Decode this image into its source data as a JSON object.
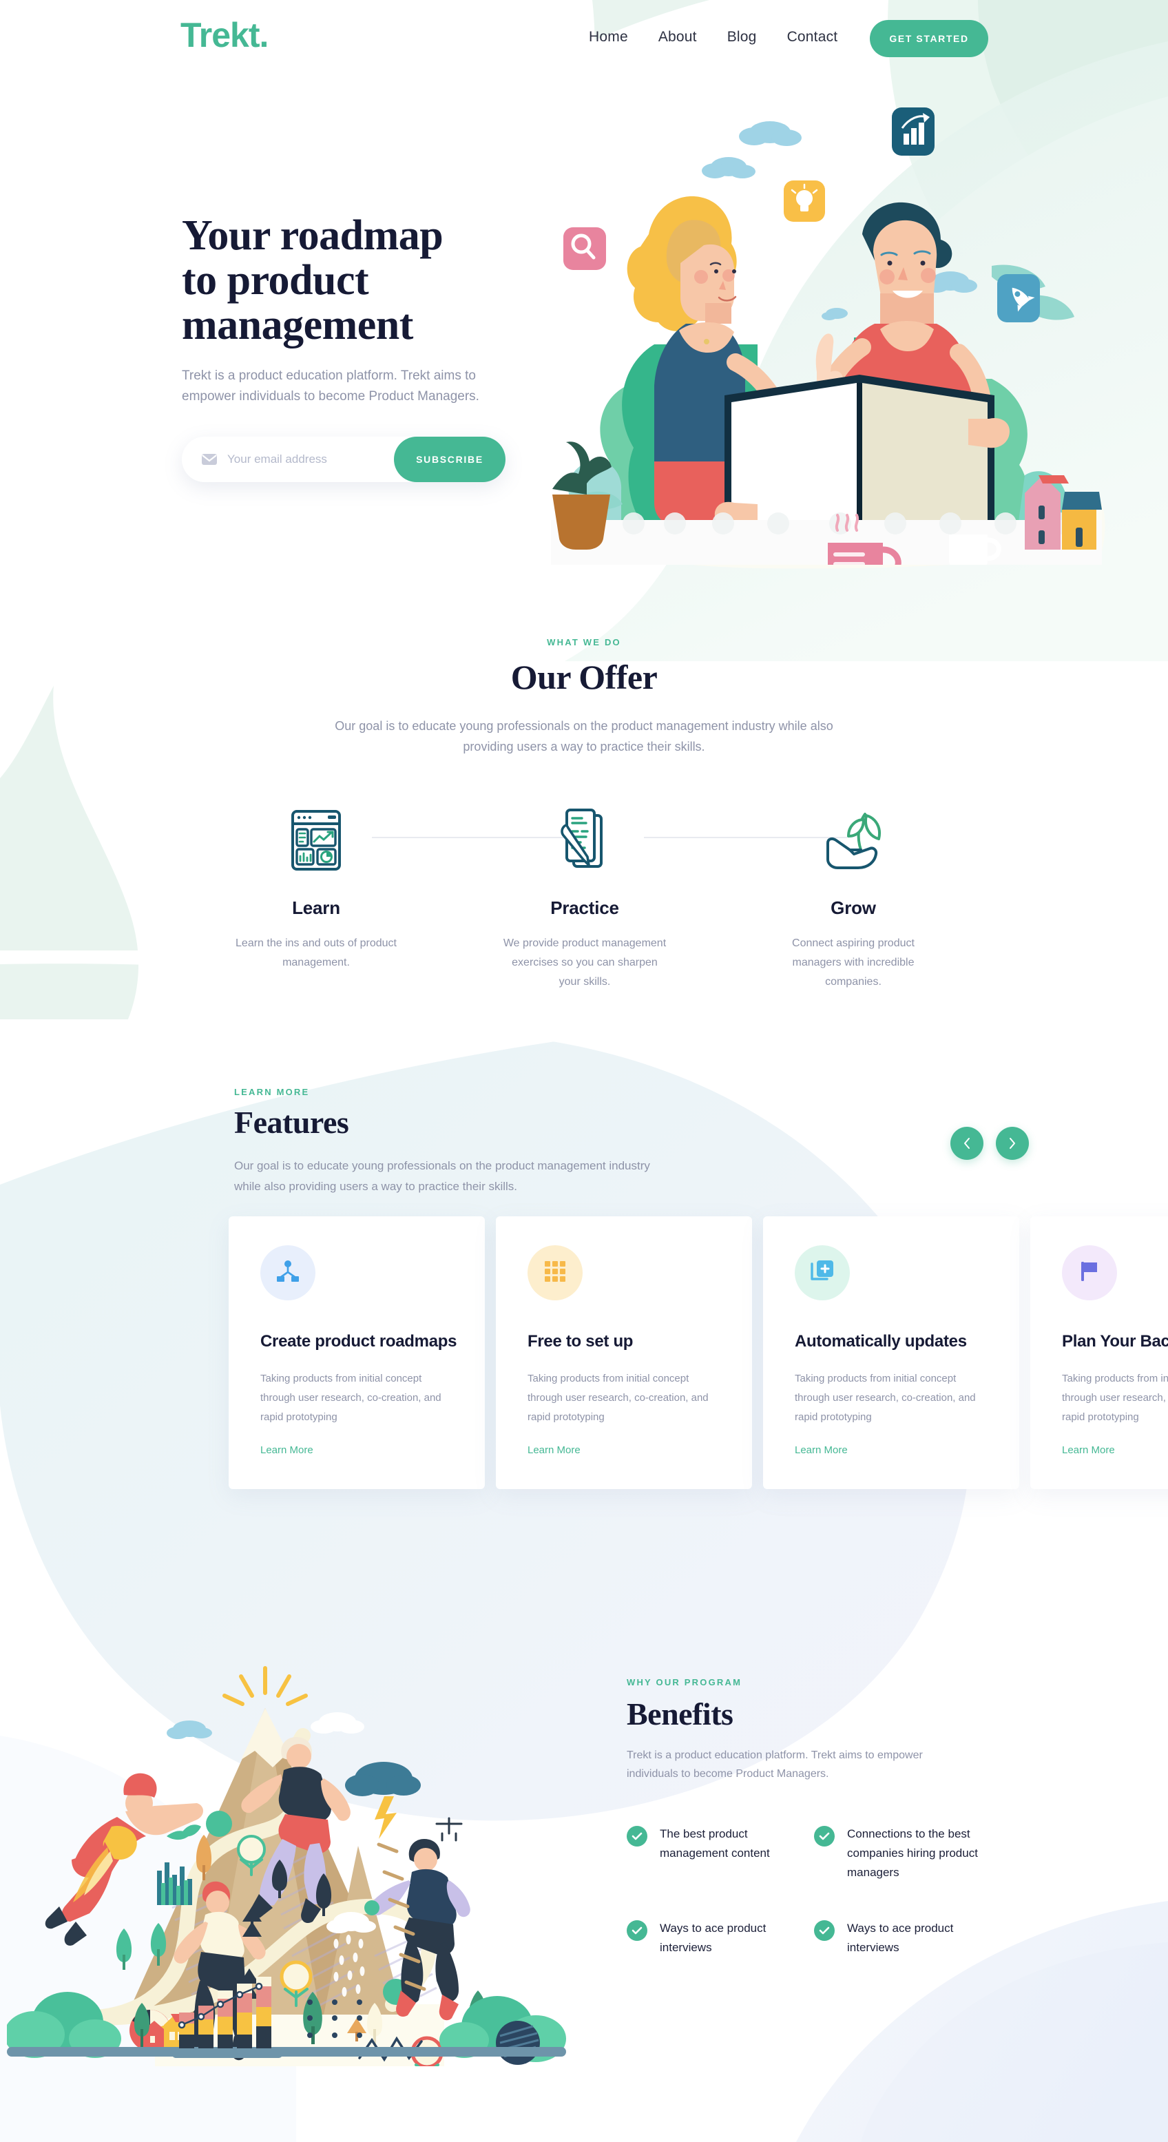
{
  "brand": {
    "logo": "Trekt."
  },
  "nav": {
    "links": [
      {
        "label": "Home"
      },
      {
        "label": "About"
      },
      {
        "label": "Blog"
      },
      {
        "label": "Contact"
      }
    ],
    "cta": "GET STARTED"
  },
  "hero": {
    "title_line1": "Your roadmap",
    "title_line2": "to product",
    "title_line3": "management",
    "subtitle": "Trekt is a product education platform. Trekt aims to empower individuals to become Product Managers.",
    "email_placeholder": "Your email address",
    "email_value": "",
    "subscribe_label": "SUBSCRIBE",
    "mail_icon": "envelope-icon"
  },
  "offer": {
    "eyebrow": "WHAT WE DO",
    "title": "Our Offer",
    "subtitle": "Our goal is to educate young professionals on the product management industry while also providing users a way to practice their skills.",
    "columns": [
      {
        "icon": "dashboard-analytics-icon",
        "title": "Learn",
        "desc": "Learn the ins and outs of product management."
      },
      {
        "icon": "document-pencil-icon",
        "title": "Practice",
        "desc": "We provide product management exercises so you can sharpen your skills."
      },
      {
        "icon": "hand-sprout-icon",
        "title": "Grow",
        "desc": "Connect aspiring product managers with incredible companies."
      }
    ]
  },
  "features": {
    "eyebrow": "LEARN MORE",
    "title": "Features",
    "subtitle": "Our goal is to educate young professionals on the product management industry while also providing users a way to practice their skills.",
    "prev_icon": "chevron-left-icon",
    "next_icon": "chevron-right-icon",
    "cards": [
      {
        "icon": "sitemap-icon",
        "icon_bg": "#e8effc",
        "icon_color": "#3fa0e8",
        "title": "Create product roadmaps",
        "desc": "Taking products from initial concept through user research, co-creation, and rapid prototyping",
        "link": "Learn More"
      },
      {
        "icon": "grid-dots-icon",
        "icon_bg": "#fdeecd",
        "icon_color": "#f7b949",
        "title": "Free to set up",
        "desc": "Taking products from initial concept through user research, co-creation, and rapid prototyping",
        "link": "Learn More"
      },
      {
        "icon": "copy-plus-icon",
        "icon_bg": "#ddf5ec",
        "icon_color": "#4fb9e8",
        "title": "Automatically updates",
        "desc": "Taking products from initial concept through user research, co-creation, and rapid prototyping",
        "link": "Learn More"
      },
      {
        "icon": "flag-icon",
        "icon_bg": "#f3e9fb",
        "icon_color": "#6b6fe0",
        "title": "Plan Your Backlog",
        "desc": "Taking products from initial concept through user research, co-creation, and rapid prototyping",
        "link": "Learn More"
      }
    ]
  },
  "benefits": {
    "eyebrow": "WHY OUR PROGRAM",
    "title": "Benefits",
    "subtitle": "Trekt is a product education platform. Trekt aims to empower individuals to become Product Managers.",
    "items": [
      {
        "text": "The best product management content",
        "icon": "check-icon"
      },
      {
        "text": "Connections to the best companies hiring product managers",
        "icon": "check-icon"
      },
      {
        "text": "Ways to ace product interviews",
        "icon": "check-icon"
      },
      {
        "text": "Ways to ace product interviews",
        "icon": "check-icon"
      }
    ],
    "illustration": "mountain-climbers-illustration"
  },
  "colors": {
    "accent_green": "#45b894",
    "heading_navy": "#161a35",
    "body_gray": "#8e93a8",
    "bg_mint": "#e8f4ef",
    "bg_lavender": "#eef1f9"
  }
}
